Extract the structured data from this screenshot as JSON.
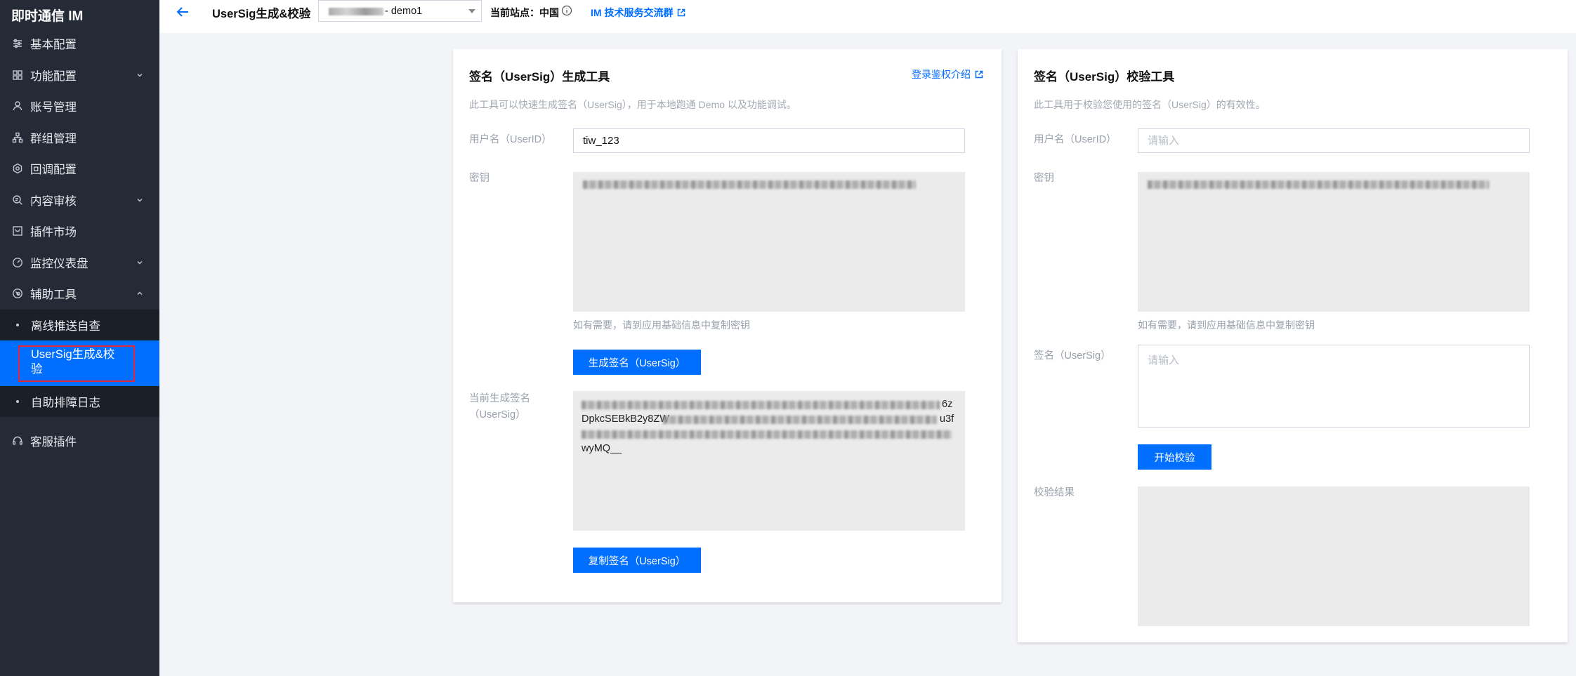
{
  "sidebar": {
    "brand": "即时通信 IM",
    "items": [
      {
        "label": "基本配置",
        "icon": "sliders-icon"
      },
      {
        "label": "功能配置",
        "icon": "grid-icon",
        "expandable": true
      },
      {
        "label": "账号管理",
        "icon": "user-icon"
      },
      {
        "label": "群组管理",
        "icon": "org-tree-icon"
      },
      {
        "label": "回调配置",
        "icon": "gear-icon"
      },
      {
        "label": "内容审核",
        "icon": "search-doc-icon",
        "expandable": true
      },
      {
        "label": "插件市场",
        "icon": "store-icon"
      },
      {
        "label": "监控仪表盘",
        "icon": "gauge-icon",
        "expandable": true
      },
      {
        "label": "辅助工具",
        "icon": "tool-icon",
        "expandable": true,
        "expanded": true
      }
    ],
    "submenu": [
      {
        "label": "离线推送自查"
      },
      {
        "label": "UserSig生成&校验",
        "active": true
      },
      {
        "label": "自助排障日志"
      }
    ],
    "bottom_item": {
      "label": "客服插件",
      "icon": "headset-icon"
    }
  },
  "topbar": {
    "title": "UserSig生成&校验",
    "app_select_value": "- demo1",
    "site_label": "当前站点：中国",
    "im_group_link": "IM 技术服务交流群"
  },
  "generator": {
    "title": "签名（UserSig）生成工具",
    "doc_link": "登录鉴权介绍",
    "description": "此工具可以快速生成签名（UserSig），用于本地跑通 Demo 以及功能调试。",
    "userid_label": "用户名（UserID）",
    "userid_value": "tiw_123",
    "secret_label": "密钥",
    "secret_hint": "如有需要，请到应用基础信息中复制密钥",
    "generate_button": "生成签名（UserSig）",
    "result_label": "当前生成签名（UserSig）",
    "result_line2_start": "DpkcSEBkB2y8ZW",
    "result_line2_end": "u3f",
    "result_line1_end": "6z",
    "result_line4": "wyMQ__",
    "copy_button": "复制签名（UserSig）"
  },
  "verifier": {
    "title": "签名（UserSig）校验工具",
    "description": "此工具用于校验您使用的签名（UserSig）的有效性。",
    "userid_label": "用户名（UserID）",
    "userid_placeholder": "请输入",
    "secret_label": "密钥",
    "secret_hint": "如有需要，请到应用基础信息中复制密钥",
    "sig_label": "签名（UserSig）",
    "sig_placeholder": "请输入",
    "verify_button": "开始校验",
    "result_label": "校验结果"
  },
  "colors": {
    "accent": "#006eff",
    "sidebar_bg": "#242b37",
    "highlight_outline": "#e0283a"
  }
}
